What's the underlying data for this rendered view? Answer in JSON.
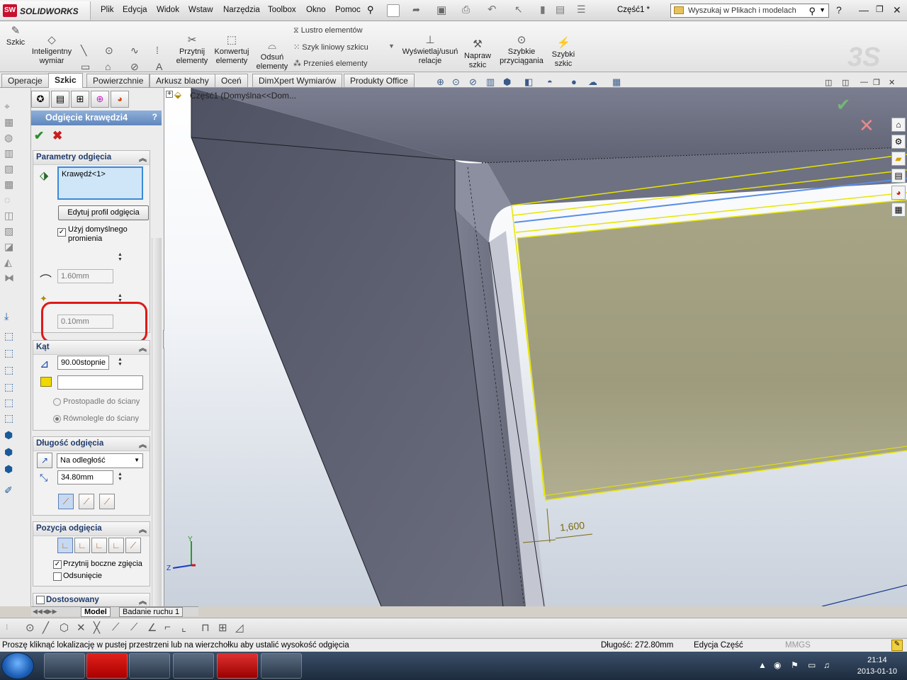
{
  "app": {
    "logo_text": "SOLIDWORKS",
    "logo_mark": "SW",
    "doc_title": "Część1 *"
  },
  "menu": [
    "Plik",
    "Edycja",
    "Widok",
    "Wstaw",
    "Narzędzia",
    "Toolbox",
    "Okno",
    "Pomoc"
  ],
  "search": {
    "placeholder": "Wyszukaj w Plikach i modelach"
  },
  "command_manager": {
    "tools": [
      {
        "label": "Szkic",
        "icon": "sketch-icon"
      },
      {
        "label": "Inteligentny\nwymiar",
        "icon": "smart-dimension-icon"
      },
      {
        "label": "Przytnij\nelementy",
        "icon": "trim-icon"
      },
      {
        "label": "Konwertuj\nelementy",
        "icon": "convert-icon"
      },
      {
        "label": "Odsuń\nelementy",
        "icon": "offset-icon"
      },
      {
        "label": "Wyświetlaj/usuń\nrelacje",
        "icon": "relations-icon"
      },
      {
        "label": "Napraw\nszkic",
        "icon": "repair-sketch-icon"
      },
      {
        "label": "Szybkie\nprzyciągania",
        "icon": "quick-snaps-icon"
      },
      {
        "label": "Szybki\nszkic",
        "icon": "rapid-sketch-icon"
      }
    ],
    "row_tools": [
      "Lustro elementów",
      "Szyk liniowy szkicu",
      "Przenieś elementy"
    ]
  },
  "tabs": [
    "Operacje",
    "Szkic",
    "Powierzchnie",
    "Arkusz blachy",
    "Oceń",
    "DimXpert Wymiarów",
    "Produkty Office"
  ],
  "active_tab": "Szkic",
  "feature_tree": {
    "root": "Część1  (Domyślna<<Dom..."
  },
  "property_manager": {
    "title": "Odgięcie krawędzi4",
    "help": "?",
    "params": {
      "header": "Parametry odgięcia",
      "selection": "Krawędź<1>",
      "edit_profile_button": "Edytuj profil odgięcia",
      "use_default_radius_label": "Użyj domyślnego promienia",
      "use_default_radius_checked": true,
      "radius_value": "1.60mm",
      "gap_value": "0.10mm"
    },
    "angle": {
      "header": "Kąt",
      "value": "90.00stopnie",
      "face_field": "",
      "perpendicular_label": "Prostopadle do ściany",
      "parallel_label": "Równolegle do ściany",
      "selected": "parallel"
    },
    "length": {
      "header": "Długość odgięcia",
      "end_condition": "Na odległość",
      "value": "34.80mm"
    },
    "position": {
      "header": "Pozycja odgięcia",
      "trim_side_bends_label": "Przytnij boczne zgięcia",
      "trim_side_bends_checked": true,
      "offset_label": "Odsunięcie",
      "offset_checked": false
    },
    "custom": {
      "header": "Dostosowany",
      "checked": false
    }
  },
  "model_tabs": [
    "Model",
    "Badanie ruchu 1"
  ],
  "viewport": {
    "dimension_label": "1,600"
  },
  "status_bar": {
    "message": "Proszę kliknąć lokalizację w pustej przestrzeni lub na wierzchołku aby ustalić wysokość odgięcia",
    "length": "Długość: 272.80mm",
    "mode": "Edycja Część",
    "units": "MMGS"
  },
  "taskbar": {
    "time": "21:14",
    "date": "2013-01-10"
  },
  "colors": {
    "accent": "#5f86bd",
    "highlight_yellow": "#e6e600",
    "panel_face": "#a39f7e",
    "part_gray": "#5a5d6e"
  }
}
